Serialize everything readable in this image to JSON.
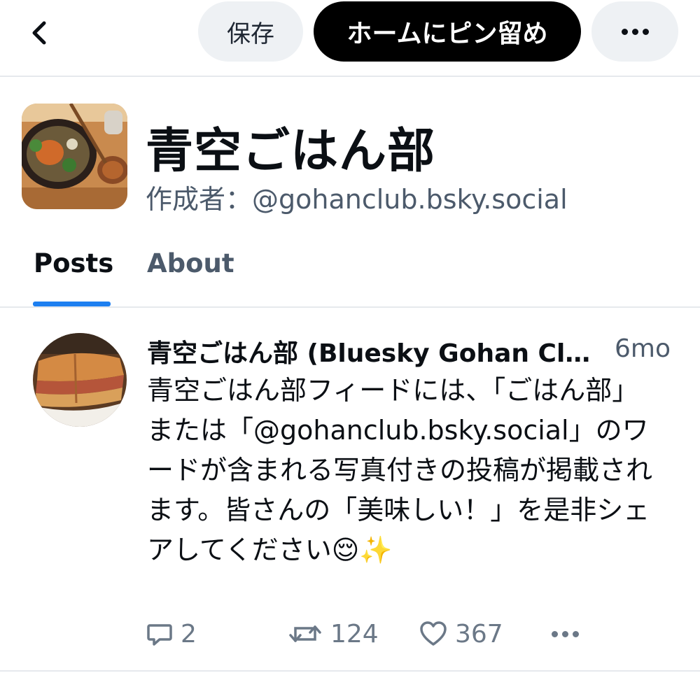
{
  "header": {
    "save_label": "保存",
    "pin_label": "ホームにピン留め"
  },
  "feed": {
    "title": "青空ごはん部",
    "creator_prefix": "作成者：",
    "creator_handle": "@gohanclub.bsky.social"
  },
  "tabs": [
    {
      "label": "Posts",
      "active": true
    },
    {
      "label": "About",
      "active": false
    }
  ],
  "post": {
    "author": "青空ごはん部 (Bluesky Gohan Cl…",
    "time": "6mo",
    "text": "青空ごはん部フィードには、「ごはん部」または「@gohanclub.bsky.social」のワードが含まれる写真付きの投稿が掲載されます。皆さんの「美味しい！」を是非シェアしてください😌✨",
    "replies": "2",
    "reposts": "124",
    "likes": "367"
  },
  "colors": {
    "accent": "#1d7ff0",
    "muted_text": "#4c5a6b",
    "pill_bg": "#eef1f4"
  },
  "icons": {
    "back": "chevron-left-icon",
    "more": "ellipsis-icon",
    "reply": "speech-bubble-icon",
    "repost": "repost-arrows-icon",
    "like": "heart-icon"
  }
}
